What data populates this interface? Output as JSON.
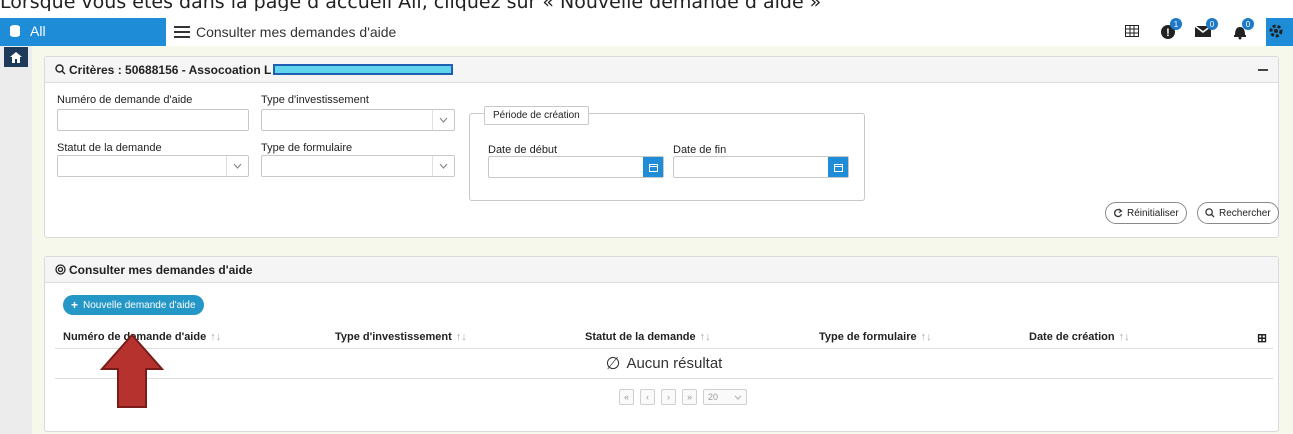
{
  "caption": "Lorsque vous êtes dans la page d’accueil All, cliquez sur « Nouvelle demande d’aide »",
  "topbar": {
    "app_label": "All",
    "page_title": "Consulter mes demandes d'aide",
    "badges": {
      "info": "1",
      "mail": "0",
      "bell": "0"
    }
  },
  "criteria": {
    "header": "Critères : 50688156 - Assocoation L",
    "fields": {
      "numero_label": "Numéro de demande d'aide",
      "type_invest_label": "Type d'investissement",
      "statut_label": "Statut de la demande",
      "type_form_label": "Type de formulaire"
    },
    "periode": {
      "legend": "Période de création",
      "date_debut_label": "Date de début",
      "date_fin_label": "Date de fin"
    },
    "reset_label": "Réinitialiser",
    "search_label": "Rechercher"
  },
  "results": {
    "header": "Consulter mes demandes d'aide",
    "new_button_label": "Nouvelle demande d'aide",
    "columns": [
      "Numéro de demande d'aide",
      "Type d'investissement",
      "Statut de la demande",
      "Type de formulaire",
      "Date de création"
    ],
    "empty_text": "Aucun résultat",
    "pager": {
      "first": "«",
      "prev": "‹",
      "next": "›",
      "last": "»",
      "page_size": "20"
    }
  },
  "colors": {
    "primary": "#1e8cd6",
    "accent_button": "#2497c7",
    "arrow": "#b5322e"
  }
}
